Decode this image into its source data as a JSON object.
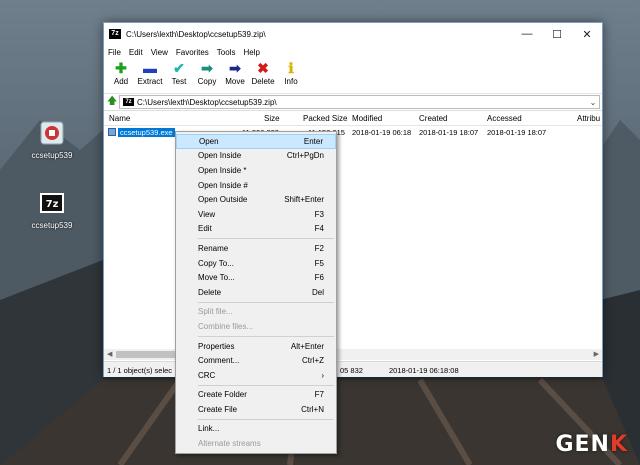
{
  "desktop": {
    "icons": [
      {
        "label": "ccsetup539"
      },
      {
        "label": "ccsetup539"
      }
    ],
    "watermark": "GENK"
  },
  "window": {
    "title": "C:\\Users\\lexth\\Desktop\\ccsetup539.zip\\",
    "app_icon": "7z",
    "menu": [
      "File",
      "Edit",
      "View",
      "Favorites",
      "Tools",
      "Help"
    ],
    "toolbar": [
      {
        "label": "Add",
        "icon": "plus-icon",
        "glyph": "✚",
        "color": "#1aa31a"
      },
      {
        "label": "Extract",
        "icon": "minus-icon",
        "glyph": "▬",
        "color": "#1f3fc2"
      },
      {
        "label": "Test",
        "icon": "check-icon",
        "glyph": "✔",
        "color": "#1fb5b5"
      },
      {
        "label": "Copy",
        "icon": "copy-arrow-icon",
        "glyph": "➡",
        "color": "#1a8f7a"
      },
      {
        "label": "Move",
        "icon": "move-arrow-icon",
        "glyph": "➡",
        "color": "#1b2a8a"
      },
      {
        "label": "Delete",
        "icon": "delete-x-icon",
        "glyph": "✖",
        "color": "#d61a1a"
      },
      {
        "label": "Info",
        "icon": "info-icon",
        "glyph": "ℹ",
        "color": "#d8b300"
      }
    ],
    "address": "C:\\Users\\lexth\\Desktop\\ccsetup539.zip\\",
    "columns": [
      "Name",
      "Size",
      "Packed Size",
      "Modified",
      "Created",
      "Accessed",
      "Attribu"
    ],
    "rows": [
      {
        "name": "ccsetup539.exe",
        "size": "11 306 832",
        "packed": "11 158 015",
        "modified": "2018-01-19 06:18",
        "created": "2018-01-19 18:07",
        "accessed": "2018-01-19 18:07"
      }
    ],
    "status": {
      "selection": "1 / 1 object(s) selec",
      "size": "05 832",
      "date": "2018-01-19 06:18:08"
    }
  },
  "context_menu": {
    "items": [
      {
        "label": "Open",
        "shortcut": "Enter",
        "highlighted": true
      },
      {
        "label": "Open Inside",
        "shortcut": "Ctrl+PgDn"
      },
      {
        "label": "Open Inside *",
        "shortcut": ""
      },
      {
        "label": "Open Inside #",
        "shortcut": ""
      },
      {
        "label": "Open Outside",
        "shortcut": "Shift+Enter"
      },
      {
        "label": "View",
        "shortcut": "F3"
      },
      {
        "label": "Edit",
        "shortcut": "F4"
      },
      {
        "separator": true
      },
      {
        "label": "Rename",
        "shortcut": "F2"
      },
      {
        "label": "Copy To...",
        "shortcut": "F5"
      },
      {
        "label": "Move To...",
        "shortcut": "F6"
      },
      {
        "label": "Delete",
        "shortcut": "Del"
      },
      {
        "separator": true
      },
      {
        "label": "Split file...",
        "shortcut": "",
        "disabled": true
      },
      {
        "label": "Combine files...",
        "shortcut": "",
        "disabled": true
      },
      {
        "separator": true
      },
      {
        "label": "Properties",
        "shortcut": "Alt+Enter"
      },
      {
        "label": "Comment...",
        "shortcut": "Ctrl+Z"
      },
      {
        "label": "CRC",
        "shortcut": "›"
      },
      {
        "separator": true
      },
      {
        "label": "Create Folder",
        "shortcut": "F7"
      },
      {
        "label": "Create File",
        "shortcut": "Ctrl+N"
      },
      {
        "separator": true
      },
      {
        "label": "Link...",
        "shortcut": ""
      },
      {
        "label": "Alternate streams",
        "shortcut": "",
        "disabled": true
      }
    ]
  }
}
